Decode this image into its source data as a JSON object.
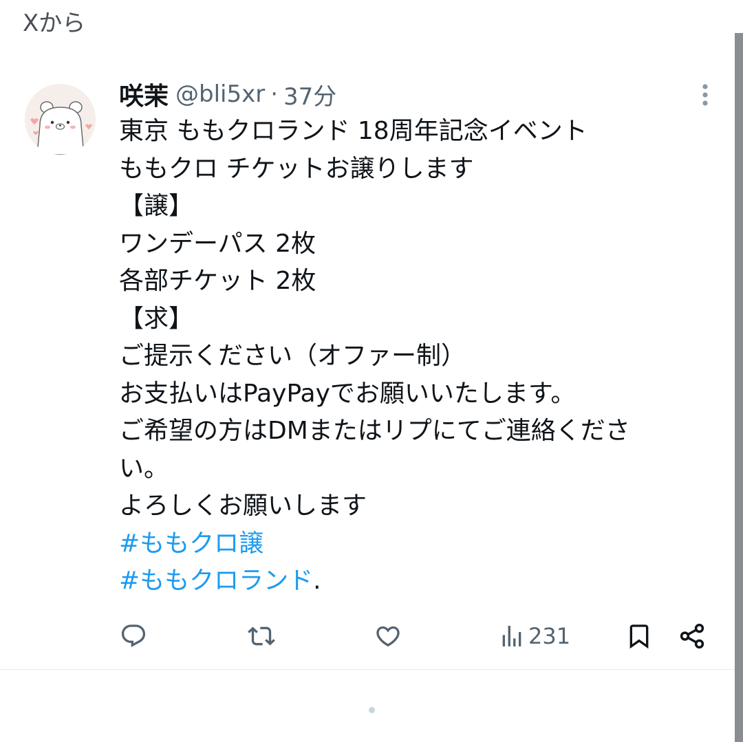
{
  "source_label": "Xから",
  "tweet": {
    "display_name": "咲茉",
    "handle": "@bli5xr",
    "separator": "·",
    "time": "37分",
    "lines": [
      "東京 ももクロランド 18周年記念イベント",
      "ももクロ チケットお譲りします",
      "【譲】",
      "ワンデーパス 2枚",
      "各部チケット 2枚",
      "【求】",
      "ご提示ください（オファー制）",
      "お支払いはPayPayでお願いいたします。",
      "ご希望の方はDMまたはリプにてご連絡くださ",
      "い。",
      "よろしくお願いします"
    ],
    "hashtags": [
      "#ももクロ譲",
      "#ももクロランド"
    ],
    "trailing_period": ".",
    "views": "231"
  },
  "icons": {
    "avatar": "bear-avatar",
    "more": "more-vertical-icon",
    "reply": "reply-icon",
    "retweet": "retweet-icon",
    "like": "heart-icon",
    "views": "views-icon",
    "bookmark": "bookmark-icon",
    "share": "share-icon"
  },
  "colors": {
    "link": "#1d9bf0",
    "secondary_text": "#536471",
    "primary_text": "#0f1419"
  }
}
